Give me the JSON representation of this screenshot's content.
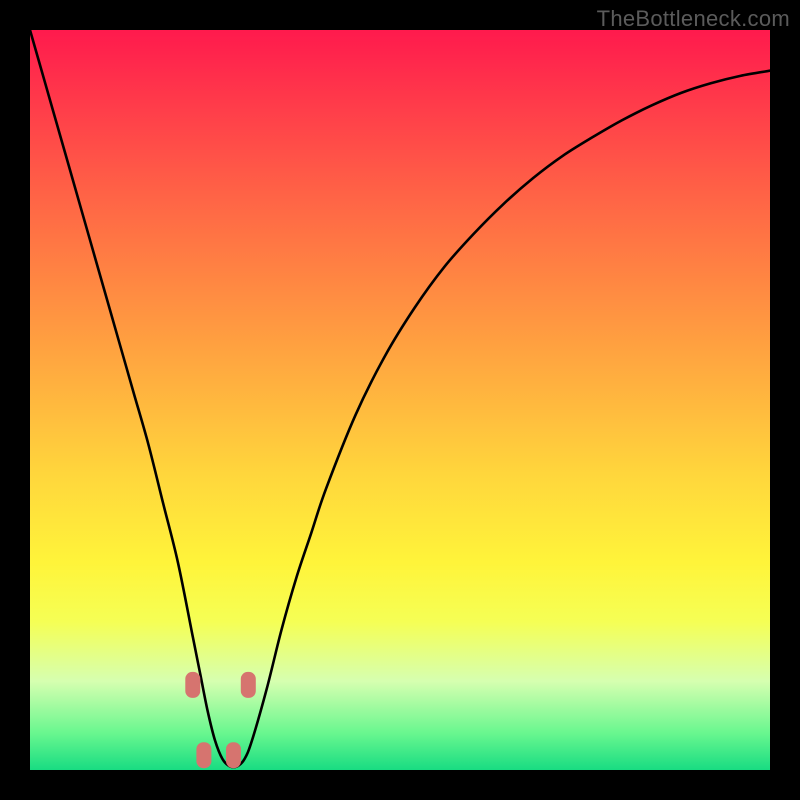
{
  "watermark": "TheBottleneck.com",
  "colors": {
    "background": "#000000",
    "gradient_top": "#ff1a4d",
    "gradient_bottom": "#18dc82",
    "curve": "#000000",
    "marker_fill": "#d6746f",
    "marker_stroke": "#d6746f"
  },
  "chart_data": {
    "type": "line",
    "title": "",
    "xlabel": "",
    "ylabel": "",
    "xlim": [
      0,
      100
    ],
    "ylim": [
      0,
      100
    ],
    "x": [
      0,
      2,
      4,
      6,
      8,
      10,
      12,
      14,
      16,
      18,
      20,
      22,
      23,
      24,
      25,
      26,
      27,
      28,
      29,
      30,
      32,
      34,
      36,
      38,
      40,
      44,
      48,
      52,
      56,
      60,
      64,
      68,
      72,
      76,
      80,
      84,
      88,
      92,
      96,
      100
    ],
    "values": [
      100.0,
      93.0,
      86.0,
      79.0,
      72.0,
      65.0,
      58.0,
      51.0,
      44.0,
      36.0,
      28.0,
      18.0,
      13.0,
      8.0,
      4.0,
      1.5,
      0.5,
      0.5,
      1.5,
      4.0,
      11.0,
      19.0,
      26.0,
      32.0,
      38.0,
      48.0,
      56.0,
      62.5,
      68.0,
      72.5,
      76.5,
      80.0,
      83.0,
      85.5,
      87.8,
      89.8,
      91.5,
      92.8,
      93.8,
      94.5
    ],
    "markers": [
      {
        "x": 22.0,
        "y": 11.5
      },
      {
        "x": 23.5,
        "y": 2.0
      },
      {
        "x": 27.5,
        "y": 2.0
      },
      {
        "x": 29.5,
        "y": 11.5
      }
    ],
    "marker_shape": "rounded-rect"
  }
}
